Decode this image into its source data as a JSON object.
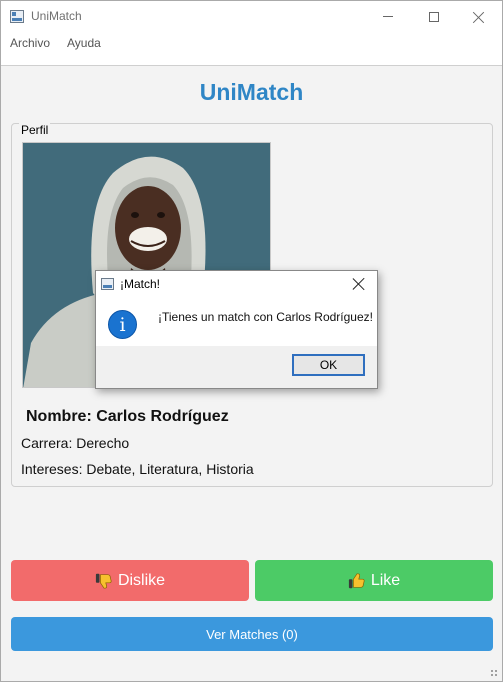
{
  "window": {
    "title": "UniMatch"
  },
  "menu": {
    "items": [
      "Archivo",
      "Ayuda"
    ]
  },
  "app_title": "UniMatch",
  "profile": {
    "group_label": "Perfil",
    "name": "Nombre: Carlos Rodríguez",
    "career": "Carrera: Derecho",
    "interests": "Intereses: Debate, Literatura, Historia"
  },
  "buttons": {
    "dislike": "Dislike",
    "like": "Like",
    "matches": "Ver Matches (0)"
  },
  "dialog": {
    "title": "¡Match!",
    "message": "¡Tienes un match con Carlos Rodríguez!",
    "ok": "OK"
  },
  "colors": {
    "title_blue": "#2f86c6",
    "dislike": "#f26b6b",
    "like": "#4ccb66",
    "matches": "#3b98dd"
  },
  "icons": {
    "dislike": "thumbs-down-icon",
    "like": "thumbs-up-icon",
    "dialog": "info-icon"
  }
}
